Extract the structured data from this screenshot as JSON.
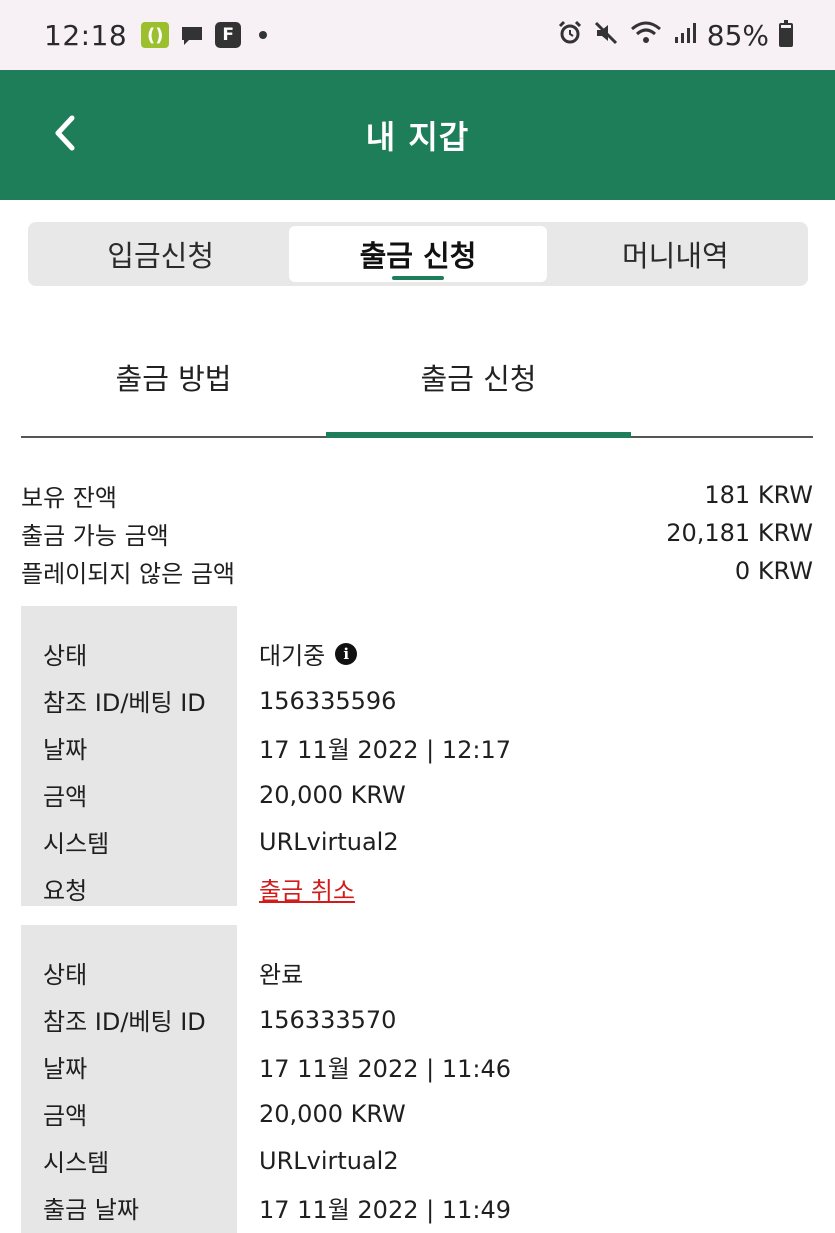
{
  "status_bar": {
    "time": "12:18",
    "app_green_glyph": "()",
    "app_f_glyph": "F",
    "battery": "85%"
  },
  "header": {
    "title": "내 지갑"
  },
  "segment_tabs": [
    {
      "label": "입금신청"
    },
    {
      "label": "출금 신청"
    },
    {
      "label": "머니내역"
    }
  ],
  "sub_tabs": [
    {
      "label": "출금 방법"
    },
    {
      "label": "출금 신청"
    }
  ],
  "balances": [
    {
      "label": "보유 잔액",
      "value": "181 KRW"
    },
    {
      "label": "출금 가능 금액",
      "value": "20,181 KRW"
    },
    {
      "label": "플레이되지 않은 금액",
      "value": "0 KRW"
    }
  ],
  "records": [
    {
      "rows": [
        {
          "label": "상태",
          "value": "대기중"
        },
        {
          "label": "참조 ID/베팅 ID",
          "value": "156335596"
        },
        {
          "label": "날짜",
          "value": "17 11월 2022 | 12:17"
        },
        {
          "label": "금액",
          "value": "20,000 KRW"
        },
        {
          "label": "시스템",
          "value": "URLvirtual2"
        },
        {
          "label": "요청",
          "value": "출금 취소"
        }
      ]
    },
    {
      "rows": [
        {
          "label": "상태",
          "value": "완료"
        },
        {
          "label": "참조 ID/베팅 ID",
          "value": "156333570"
        },
        {
          "label": "날짜",
          "value": "17 11월 2022 | 11:46"
        },
        {
          "label": "금액",
          "value": "20,000 KRW"
        },
        {
          "label": "시스템",
          "value": "URLvirtual2"
        },
        {
          "label": "출금 날짜",
          "value": "17 11월 2022 | 11:49"
        }
      ]
    }
  ],
  "colors": {
    "brand_green": "#1e7e5a",
    "cancel_red": "#d21c1c",
    "status_bar_bg": "#f7f1f6"
  },
  "icons": {
    "back": "chevron-left-icon",
    "info": "info-icon"
  }
}
